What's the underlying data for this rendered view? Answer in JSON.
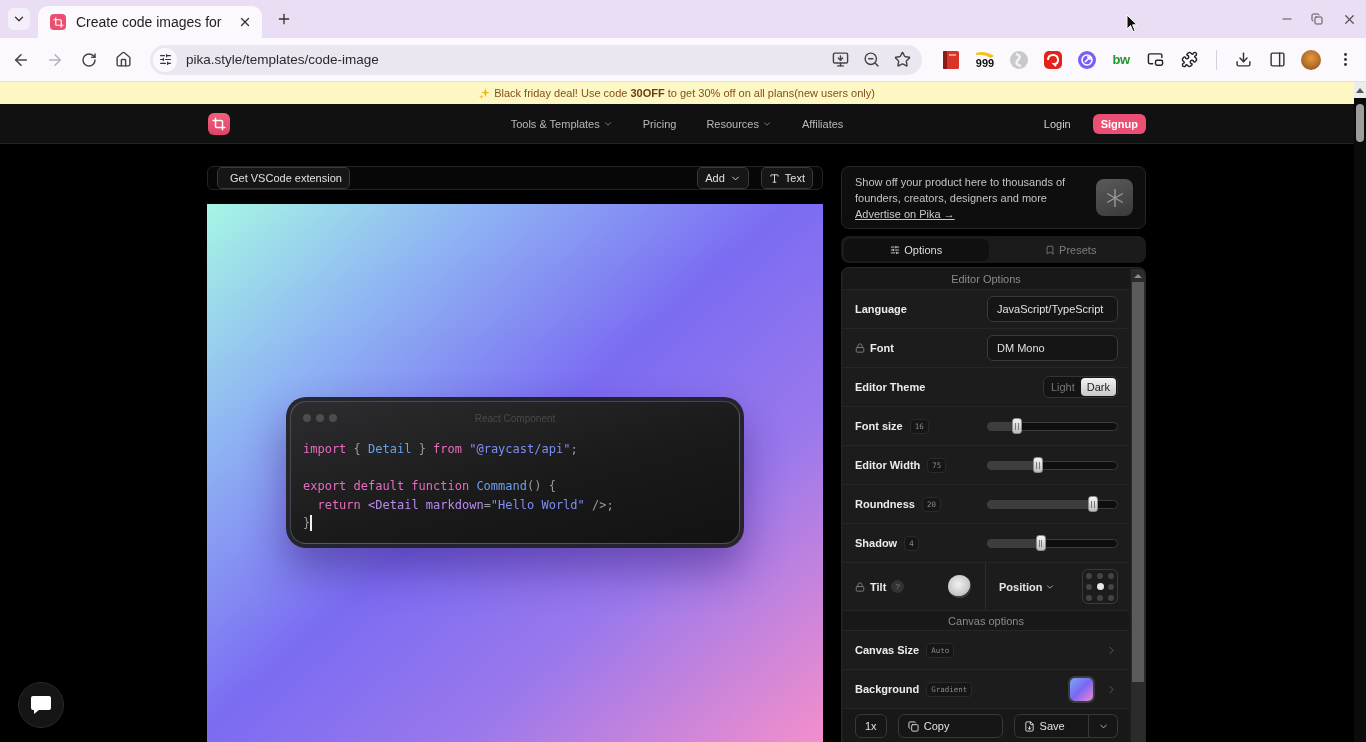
{
  "browser": {
    "tab_title": "Create code images for",
    "url": "pika.style/templates/code-image",
    "forward_disabled": true,
    "extension_count": "999",
    "extension_logo": "bw"
  },
  "banner": {
    "text": "Black friday deal! Use code **30OFF** to get 30% off on all plans(new users only)"
  },
  "site_header": {
    "nav": [
      {
        "label": "Tools & Templates",
        "has_menu": true
      },
      {
        "label": "Pricing",
        "has_menu": false
      },
      {
        "label": "Resources",
        "has_menu": true
      },
      {
        "label": "Affiliates",
        "has_menu": false
      }
    ],
    "login": "Login",
    "signup": "Signup"
  },
  "editor_toolbar": {
    "extension_button": "Get VSCode extension",
    "add_button": "Add",
    "text_button": "Text"
  },
  "code_window": {
    "title": "React Component",
    "lines": [
      {
        "kind": "code",
        "cursor": false,
        "tokens": [
          {
            "text": "import",
            "kind": "keyword"
          },
          {
            "text": " { ",
            "kind": "punct"
          },
          {
            "text": "Detail",
            "kind": "name"
          },
          {
            "text": " } ",
            "kind": "punct"
          },
          {
            "text": "from",
            "kind": "keyword"
          },
          {
            "text": " \"@raycast/api\"",
            "kind": "string"
          },
          {
            "text": ";",
            "kind": "punct"
          }
        ]
      },
      {
        "kind": "blank"
      },
      {
        "kind": "code",
        "cursor": false,
        "tokens": [
          {
            "text": "export default function ",
            "kind": "keyword"
          },
          {
            "text": "Command",
            "kind": "name"
          },
          {
            "text": "() {",
            "kind": "punct"
          }
        ]
      },
      {
        "kind": "code",
        "cursor": false,
        "tokens": [
          {
            "text": "  return ",
            "kind": "keyword"
          },
          {
            "text": "<Detail markdown",
            "kind": "tag"
          },
          {
            "text": "=",
            "kind": "punct"
          },
          {
            "text": "\"Hello World\"",
            "kind": "string"
          },
          {
            "text": " />;",
            "kind": "punct"
          }
        ]
      },
      {
        "kind": "code",
        "cursor": true,
        "tokens": [
          {
            "text": "}",
            "kind": "punct"
          }
        ]
      }
    ]
  },
  "ad": {
    "text": "Show off your product here to thousands of founders, creators, designers and more",
    "link": "Advertise on Pika →"
  },
  "panel_tabs": [
    {
      "label": "Options",
      "selected": true
    },
    {
      "label": "Presets",
      "selected": false
    }
  ],
  "editor_options": {
    "title": "Editor Options",
    "rows": [
      {
        "kind": "select",
        "label": "Language",
        "locked": false,
        "value": "JavaScript/TypeScript"
      },
      {
        "kind": "select",
        "label": "Font",
        "locked": true,
        "value": "DM Mono"
      },
      {
        "kind": "toggle",
        "label": "Editor Theme",
        "locked": false,
        "options": [
          {
            "label": "Light",
            "selected": false
          },
          {
            "label": "Dark",
            "selected": true
          }
        ]
      },
      {
        "kind": "slider",
        "label": "Font size",
        "locked": false,
        "reading": "16",
        "level": 0.23
      },
      {
        "kind": "slider",
        "label": "Editor Width",
        "locked": false,
        "reading": "75",
        "level": 0.39
      },
      {
        "kind": "slider",
        "label": "Roundness",
        "locked": false,
        "reading": "20",
        "level": 0.81
      },
      {
        "kind": "slider",
        "label": "Shadow",
        "locked": false,
        "reading": "4",
        "level": 0.41
      },
      {
        "kind": "tilt_position",
        "label": "Tilt",
        "locked": true,
        "help": "?",
        "position_label": "Position",
        "cells": [
          {
            "selected": false
          },
          {
            "selected": false
          },
          {
            "selected": false
          },
          {
            "selected": false
          },
          {
            "selected": true
          },
          {
            "selected": false
          },
          {
            "selected": false
          },
          {
            "selected": false
          },
          {
            "selected": false
          }
        ]
      }
    ]
  },
  "canvas_options": {
    "title": "Canvas options",
    "rows": [
      {
        "kind": "chevron",
        "label": "Canvas Size",
        "badge": "Auto"
      },
      {
        "kind": "swatch",
        "label": "Background",
        "badge": "Gradient"
      }
    ]
  },
  "actions": {
    "scale": "1x",
    "copy": "Copy",
    "save": "Save"
  }
}
